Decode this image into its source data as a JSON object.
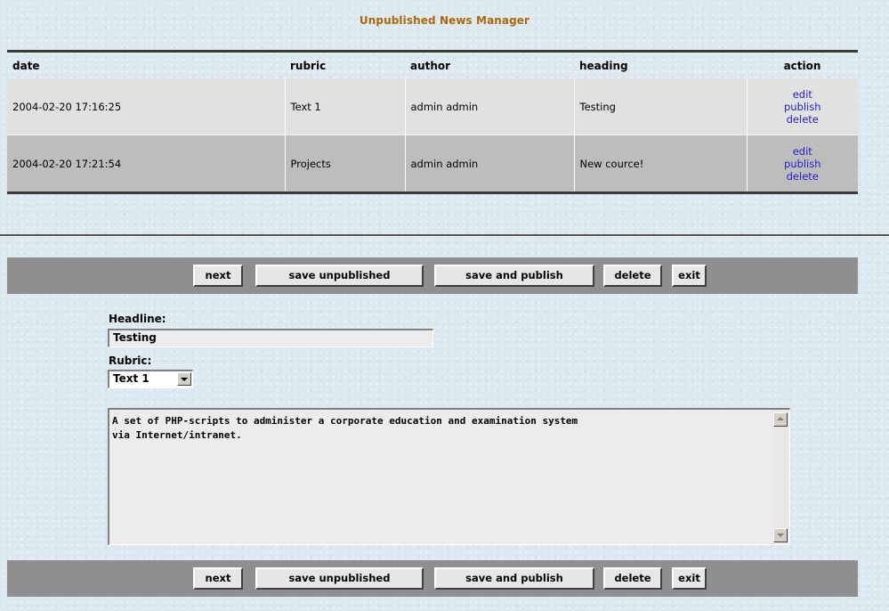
{
  "page": {
    "title": "Unpublished News Manager"
  },
  "table": {
    "columns": {
      "date": "date",
      "rubric": "rubric",
      "author": "author",
      "heading": "heading",
      "action": "action"
    },
    "rows": [
      {
        "date": "2004-02-20 17:16:25",
        "rubric": "Text 1",
        "author": "admin admin",
        "heading": "Testing",
        "actions": {
          "edit": "edit",
          "publish": "publish",
          "delete": "delete"
        }
      },
      {
        "date": "2004-02-20 17:21:54",
        "rubric": "Projects",
        "author": "admin admin",
        "heading": "New cource!",
        "actions": {
          "edit": "edit",
          "publish": "publish",
          "delete": "delete"
        }
      }
    ]
  },
  "toolbar": {
    "next": "next",
    "save_unpublished": "save unpublished",
    "save_and_publish": "save and publish",
    "delete": "delete",
    "exit": "exit"
  },
  "form": {
    "headline_label": "Headline:",
    "headline_value": "Testing",
    "rubric_label": "Rubric:",
    "rubric_value": "Text 1",
    "body_text": "A set of PHP-scripts to administer a corporate education and examination system\nvia Internet/intranet."
  },
  "colors": {
    "title": "#b0670a",
    "link": "#2222cc",
    "toolbar_bg": "#8f8f8f",
    "page_bg": "#dde9f1"
  }
}
